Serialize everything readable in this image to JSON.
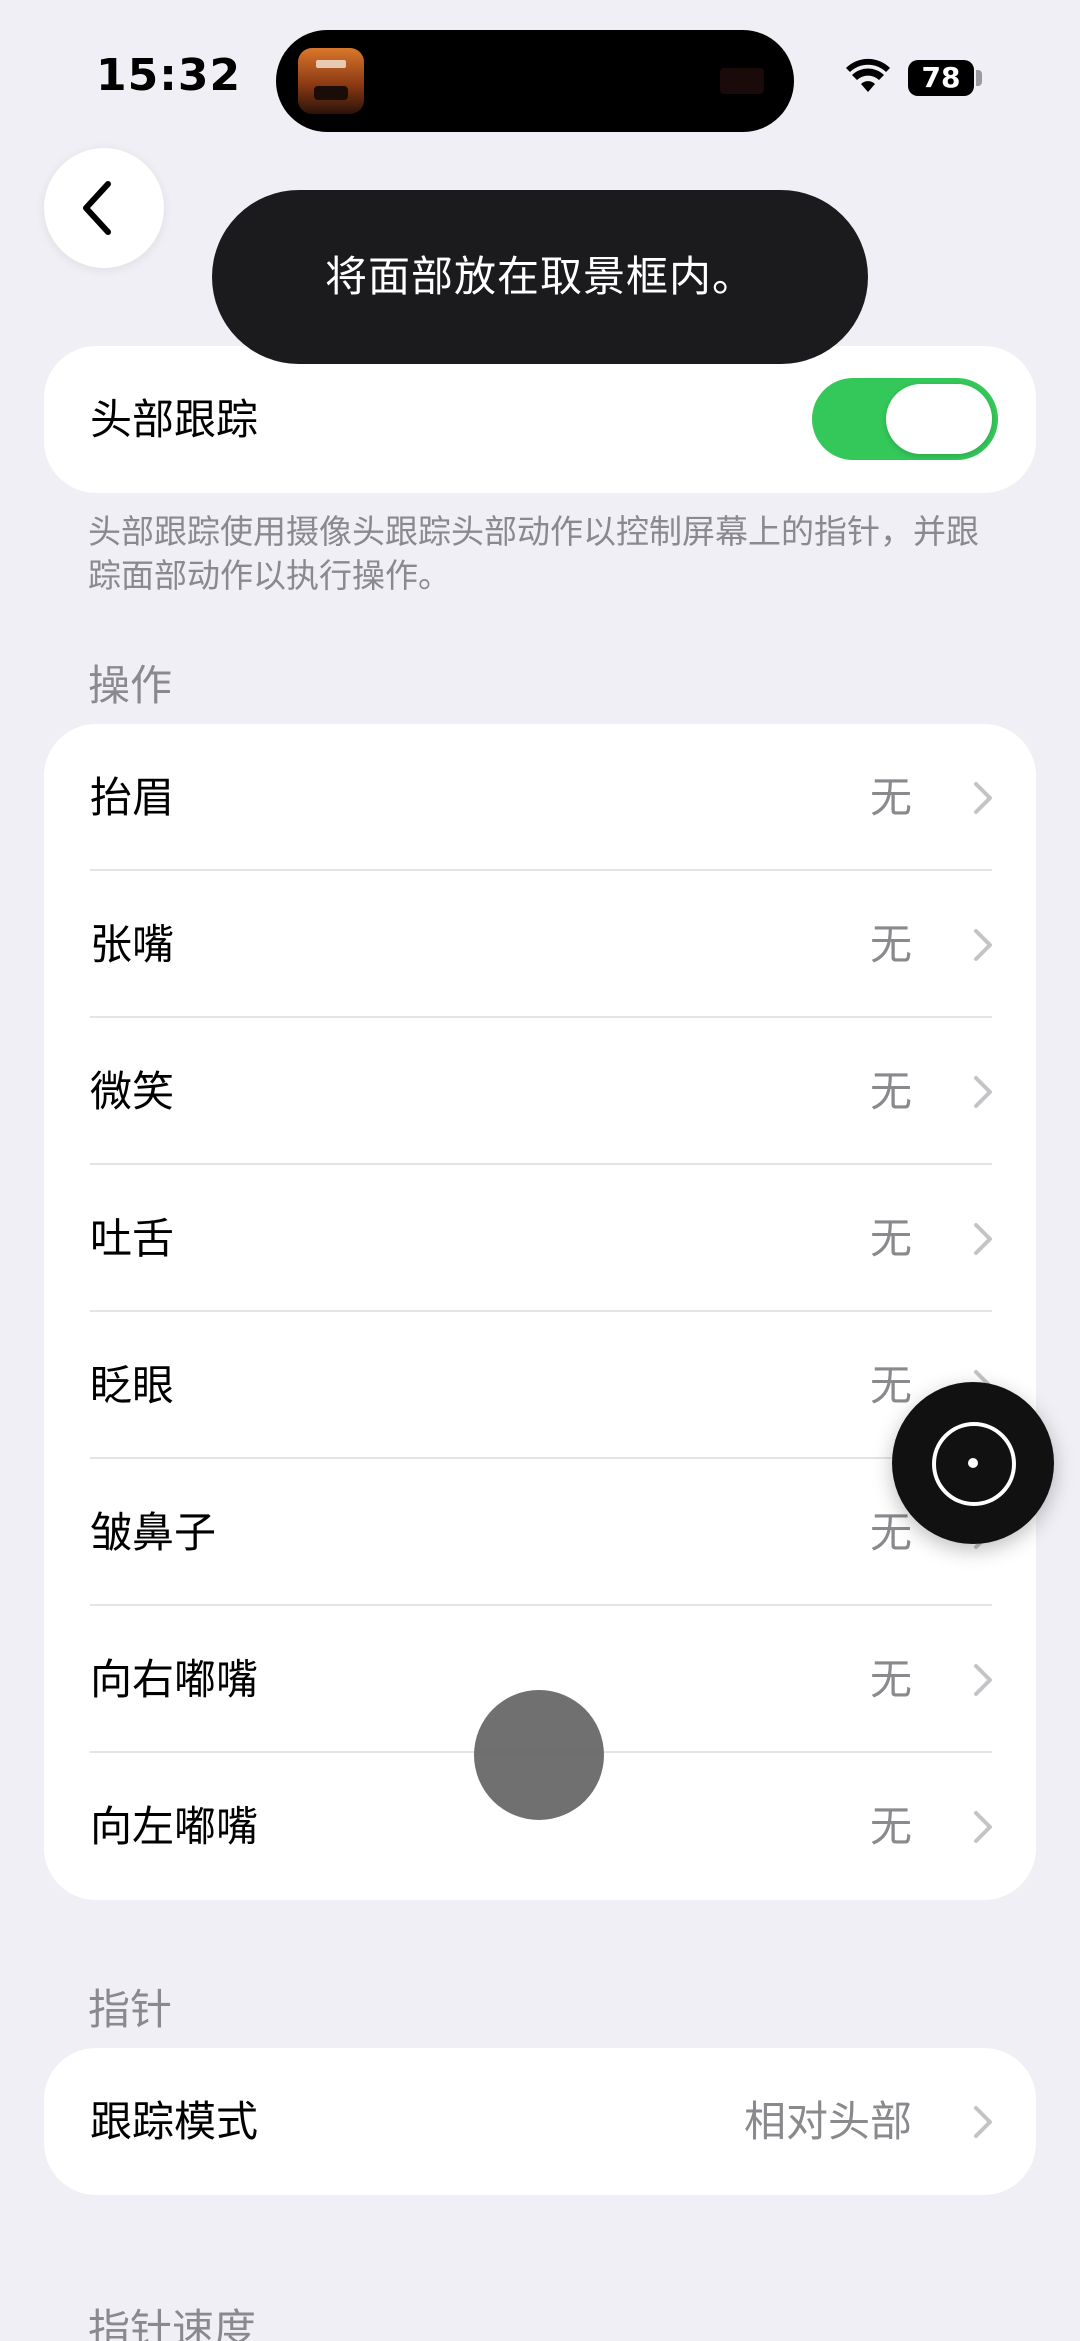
{
  "status_bar": {
    "time": "15:32",
    "battery": "78"
  },
  "toast": {
    "message": "将面部放在取景框内。"
  },
  "head_tracking": {
    "label": "头部跟踪",
    "enabled": true,
    "description": "头部跟踪使用摄像头跟踪头部动作以控制屏幕上的指针，并跟踪面部动作以执行操作。"
  },
  "actions": {
    "header": "操作",
    "items": [
      {
        "label": "抬眉",
        "value": "无"
      },
      {
        "label": "张嘴",
        "value": "无"
      },
      {
        "label": "微笑",
        "value": "无"
      },
      {
        "label": "吐舌",
        "value": "无"
      },
      {
        "label": "眨眼",
        "value": "无"
      },
      {
        "label": "皱鼻子",
        "value": "无"
      },
      {
        "label": "向右嘟嘴",
        "value": "无"
      },
      {
        "label": "向左嘟嘴",
        "value": "无"
      }
    ]
  },
  "pointer": {
    "header": "指针",
    "tracking_mode_label": "跟踪模式",
    "tracking_mode_value": "相对头部"
  },
  "pointer_speed": {
    "header": "指针速度"
  },
  "colors": {
    "background": "#F0EFF5",
    "toggle_on": "#34C759",
    "secondary_text": "#8A8A8E"
  }
}
